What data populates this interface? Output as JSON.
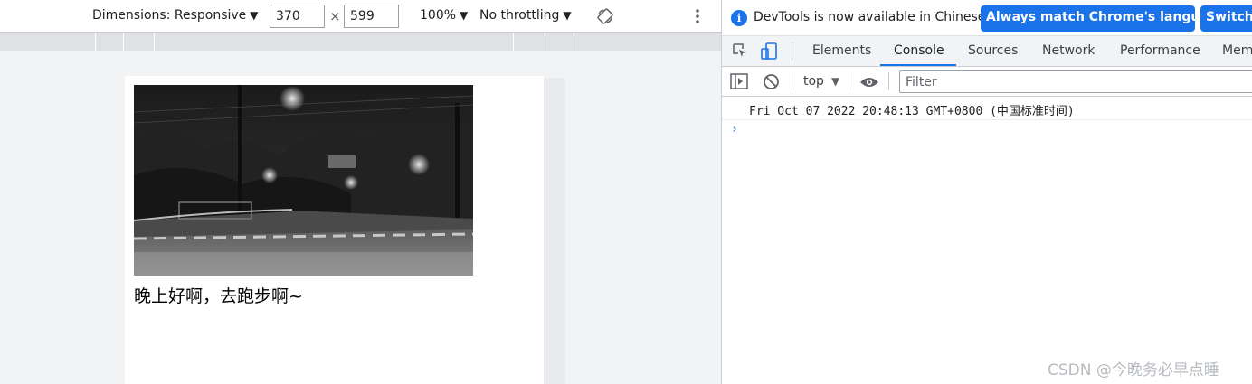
{
  "emulation": {
    "dimensions_label": "Dimensions: Responsive",
    "width": "370",
    "height": "599",
    "times": "×",
    "zoom": "100%",
    "throttling": "No throttling",
    "caret": "▼"
  },
  "page": {
    "caption": "晚上好啊，去跑步啊~"
  },
  "devtools": {
    "info_text": "DevTools is now available in Chinese!",
    "match_button": "Always match Chrome's language",
    "switch_button": "Switch D",
    "tabs": [
      "Elements",
      "Console",
      "Sources",
      "Network",
      "Performance",
      "Mem"
    ],
    "active_tab": "Console",
    "context": "top",
    "filter_placeholder": "Filter",
    "log_message": "Fri Oct 07 2022 20:48:13 GMT+0800 (中国标准时间)",
    "prompt_glyph": "›"
  },
  "watermark": "CSDN @今晚务必早点睡",
  "colors": {
    "accent": "#1a73e8",
    "panel_bg": "#f1f3f4"
  }
}
